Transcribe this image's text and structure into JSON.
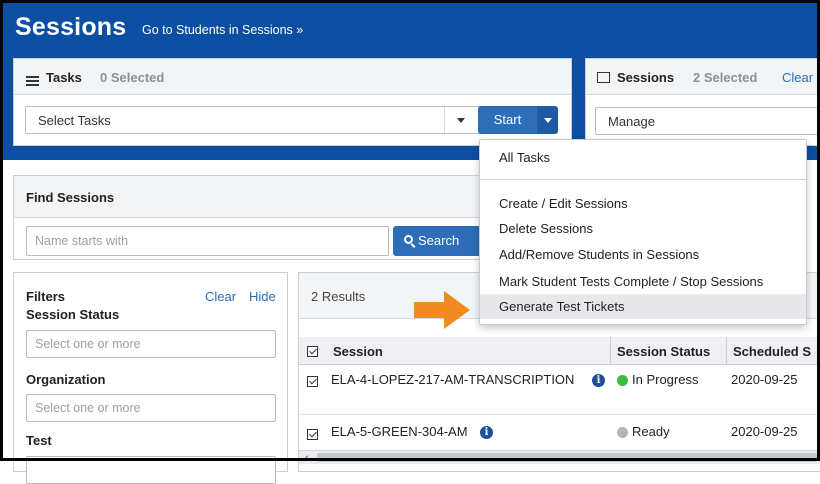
{
  "header": {
    "title": "Sessions",
    "link": "Go to Students in Sessions »"
  },
  "tasks_panel": {
    "title": "Tasks",
    "selected": "0 Selected",
    "select_value": "Select Tasks",
    "start_label": "Start"
  },
  "sessions_panel": {
    "title": "Sessions",
    "selected": "2 Selected",
    "clear_label": "Clear",
    "select_value": "Manage"
  },
  "dropdown": {
    "items": [
      "All Tasks",
      "Create / Edit Sessions",
      "Delete Sessions",
      "Add/Remove Students in Sessions",
      "Mark Student Tests Complete / Stop Sessions",
      "Generate Test Tickets"
    ],
    "highlighted": "Generate Test Tickets"
  },
  "find_sessions": {
    "title": "Find Sessions",
    "name_placeholder": "Name starts with",
    "search_label": "Search"
  },
  "filters": {
    "title": "Filters",
    "clear_label": "Clear",
    "hide_label": "Hide",
    "session_status_label": "Session Status",
    "session_status_placeholder": "Select one or more",
    "organization_label": "Organization",
    "organization_placeholder": "Select one or more",
    "test_label": "Test"
  },
  "results": {
    "count": "2 Results",
    "columns": [
      "Session",
      "Session Status",
      "Scheduled S"
    ],
    "rows": [
      {
        "session": "ELA-4-LOPEZ-217-AM-TRANSCRIPTION",
        "status": "In Progress",
        "status_color": "#3dbb3d",
        "scheduled": "2020-09-25"
      },
      {
        "session": "ELA-5-GREEN-304-AM",
        "status": "Ready",
        "status_color": "#b5b5b5",
        "scheduled": "2020-09-25"
      }
    ]
  },
  "colors": {
    "header_blue": "#0b4ea2",
    "button_blue": "#2e6db7",
    "arrow_orange": "#f08a22"
  }
}
